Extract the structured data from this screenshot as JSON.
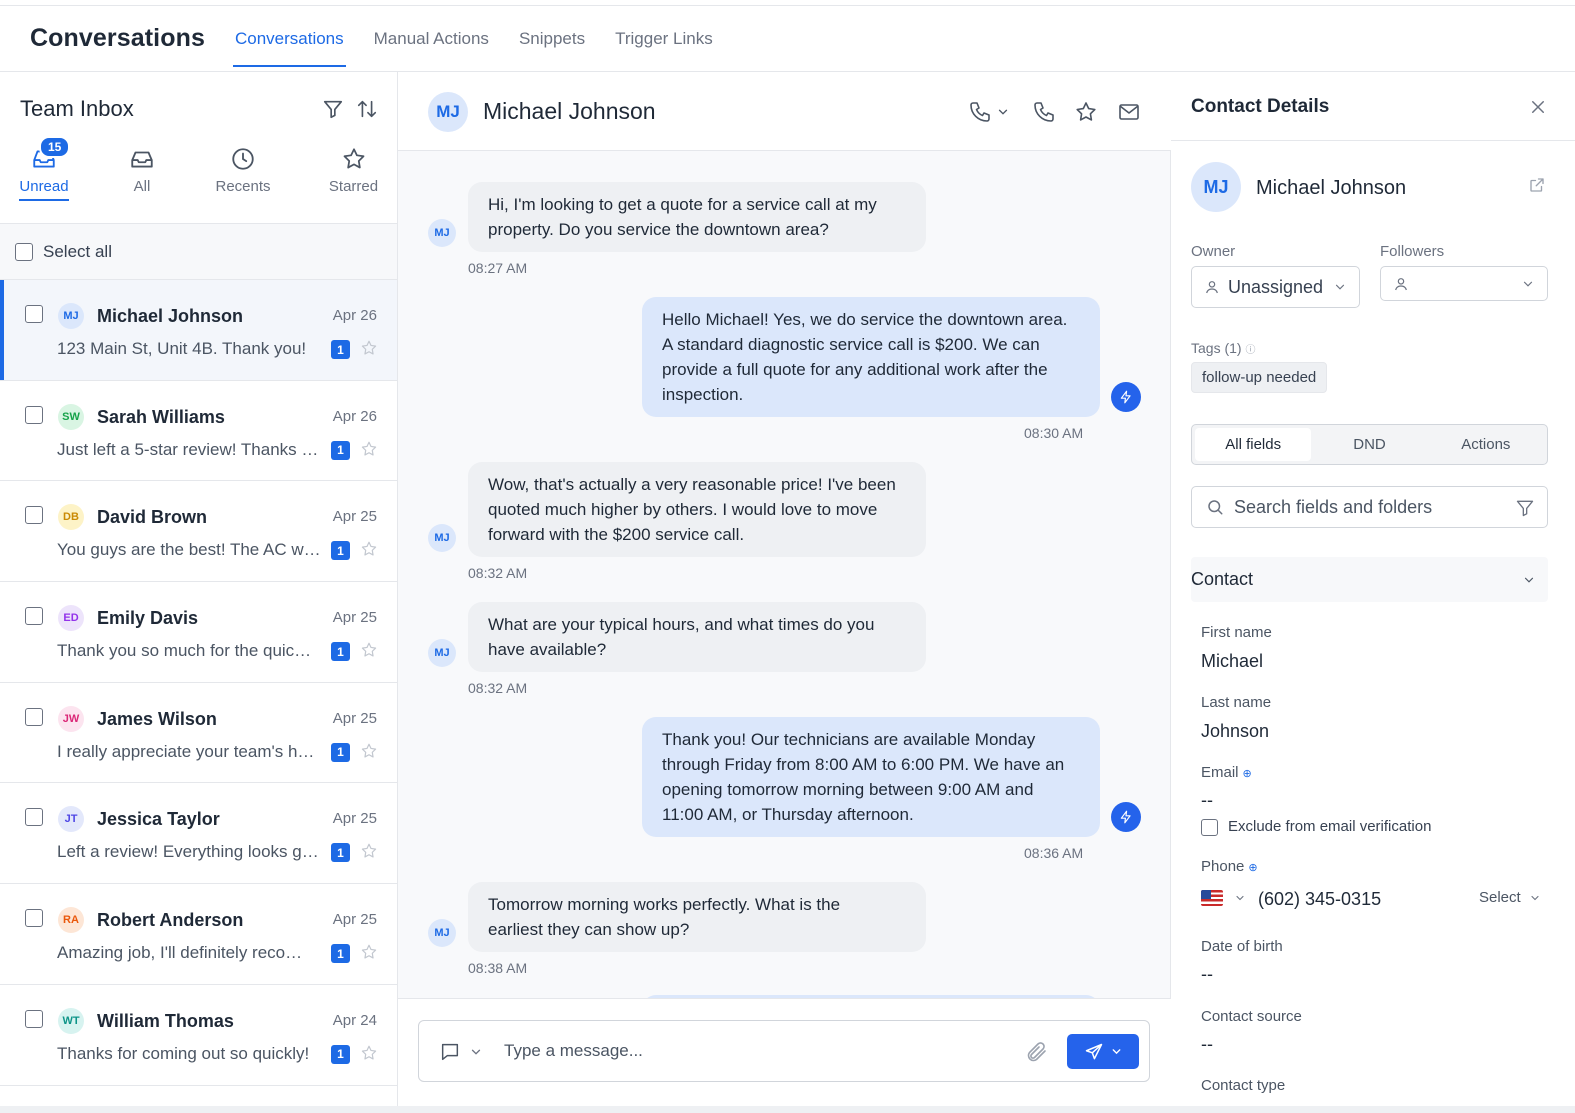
{
  "header": {
    "app_title": "Conversations",
    "tabs": [
      {
        "label": "Conversations",
        "active": true
      },
      {
        "label": "Manual Actions",
        "active": false
      },
      {
        "label": "Snippets",
        "active": false
      },
      {
        "label": "Trigger Links",
        "active": false
      }
    ]
  },
  "inbox": {
    "title": "Team Inbox",
    "filters": [
      {
        "label": "Unread",
        "icon": "inbox-icon",
        "badge": "15",
        "active": true
      },
      {
        "label": "All",
        "icon": "inbox-tray-icon",
        "active": false
      },
      {
        "label": "Recents",
        "icon": "clock-icon",
        "active": false
      },
      {
        "label": "Starred",
        "icon": "star-icon",
        "active": false
      }
    ],
    "select_all": "Select all",
    "conversations": [
      {
        "initials": "MJ",
        "name": "Michael Johnson",
        "date": "Apr 26",
        "preview": "123 Main St, Unit 4B. Thank you!",
        "unread": "1",
        "bg": "#dbe7fb",
        "fg": "#1d6ae5"
      },
      {
        "initials": "SW",
        "name": "Sarah Williams",
        "date": "Apr 26",
        "preview": "Just left a 5-star review! Thanks …",
        "unread": "1",
        "bg": "#d9f5e3",
        "fg": "#16a34a"
      },
      {
        "initials": "DB",
        "name": "David Brown",
        "date": "Apr 25",
        "preview": "You guys are the best! The AC w…",
        "unread": "1",
        "bg": "#fdf3c7",
        "fg": "#ca8a04"
      },
      {
        "initials": "ED",
        "name": "Emily Davis",
        "date": "Apr 25",
        "preview": "Thank you so much for the quic…",
        "unread": "1",
        "bg": "#ede4fb",
        "fg": "#9333ea"
      },
      {
        "initials": "JW",
        "name": "James Wilson",
        "date": "Apr 25",
        "preview": "I really appreciate your team's h…",
        "unread": "1",
        "bg": "#fce4ef",
        "fg": "#db2777"
      },
      {
        "initials": "JT",
        "name": "Jessica Taylor",
        "date": "Apr 25",
        "preview": "Left a review! Everything looks g…",
        "unread": "1",
        "bg": "#e3e8fb",
        "fg": "#4f46e5"
      },
      {
        "initials": "RA",
        "name": "Robert Anderson",
        "date": "Apr 25",
        "preview": "Amazing job, I'll definitely reco…",
        "unread": "1",
        "bg": "#fde6d6",
        "fg": "#ea580c"
      },
      {
        "initials": "WT",
        "name": "William Thomas",
        "date": "Apr 24",
        "preview": "Thanks for coming out so quickly!",
        "unread": "1",
        "bg": "#d7f3f0",
        "fg": "#0d9488"
      }
    ]
  },
  "chat": {
    "contact_initials": "MJ",
    "contact_name": "Michael Johnson",
    "messages": [
      {
        "dir": "in",
        "lines": [
          "Hi, I'm looking to get a quote for a service call at my",
          "property. Do you service the downtown area?"
        ],
        "time": "08:27 AM"
      },
      {
        "dir": "out",
        "lines": [
          "Hello Michael! Yes, we do service the downtown area.",
          "A standard diagnostic service call is $200. We can",
          "provide a full quote for any additional work after the",
          "inspection."
        ],
        "time": "08:30 AM"
      },
      {
        "dir": "in",
        "lines": [
          "Wow, that's actually a very reasonable price! I've been",
          "quoted much higher by others. I would love to move",
          "forward with the $200 service call."
        ],
        "time": "08:32 AM"
      },
      {
        "dir": "in",
        "lines": [
          "What are your typical hours, and what times do you",
          "have available?"
        ],
        "time": "08:32 AM"
      },
      {
        "dir": "out",
        "lines": [
          "Thank you! Our technicians are available Monday",
          "through Friday from 8:00 AM to 6:00 PM. We have an",
          "opening tomorrow morning between 9:00 AM and",
          "11:00 AM, or Thursday afternoon."
        ],
        "time": "08:36 AM"
      },
      {
        "dir": "in",
        "lines": [
          "Tomorrow morning works perfectly. What is the",
          "earliest they can show up?"
        ],
        "time": "08:38 AM"
      }
    ],
    "composer_placeholder": "Type a message..."
  },
  "contact": {
    "panel_title": "Contact Details",
    "initials": "MJ",
    "name": "Michael Johnson",
    "owner_label": "Owner",
    "owner_value": "Unassigned",
    "followers_label": "Followers",
    "tags_label": "Tags (1)",
    "tags": [
      "follow-up needed"
    ],
    "segments": [
      "All fields",
      "DND",
      "Actions"
    ],
    "search_placeholder": "Search fields and folders",
    "section_title": "Contact",
    "fields": {
      "first_name_label": "First name",
      "first_name": "Michael",
      "last_name_label": "Last name",
      "last_name": "Johnson",
      "email_label": "Email",
      "email": "--",
      "exclude_label": "Exclude from email verification",
      "phone_label": "Phone",
      "phone": "(602) 345-0315",
      "phone_type": "Select",
      "dob_label": "Date of birth",
      "dob": "--",
      "source_label": "Contact source",
      "source": "--",
      "type_label": "Contact type"
    }
  },
  "colors": {
    "accent": "#1d6ae5",
    "outgoing_bubble": "#dbe7fb",
    "incoming_bubble": "#eef0f3"
  }
}
